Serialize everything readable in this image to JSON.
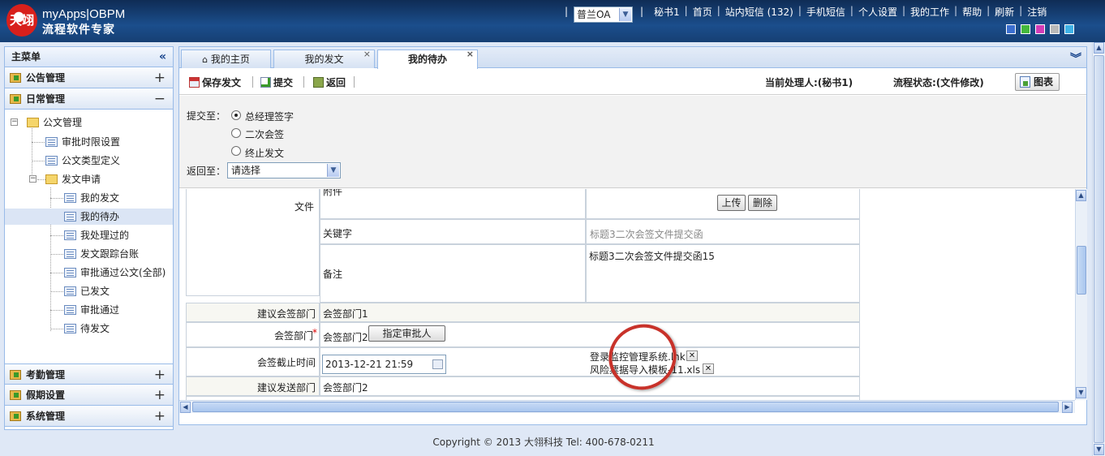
{
  "app": {
    "logo_mark": "天翊",
    "title": "myApps|OBPM",
    "subtitle": "流程软件专家"
  },
  "header": {
    "system_select": "普兰OA",
    "links": [
      "秘书1",
      "首页",
      "站内短信 (132)",
      "手机短信",
      "个人设置",
      "我的工作",
      "帮助",
      "刷新",
      "注销"
    ],
    "theme_colors": [
      "#3b6fd0",
      "#45b83c",
      "#d23cb7",
      "#b9b9b9",
      "#3fb2e6"
    ]
  },
  "sidebar": {
    "title": "主菜单",
    "collapse_icon": "«",
    "sections_top": [
      {
        "label": "公告管理",
        "toggle": "+"
      },
      {
        "label": "日常管理",
        "toggle": "−"
      }
    ],
    "tree": {
      "root": "公文管理",
      "items_level1": [
        "审批时限设置",
        "公文类型定义"
      ],
      "folder": "发文申请",
      "items_level2": [
        "我的发文",
        "我的待办",
        "我处理过的",
        "发文跟踪台账",
        "审批通过公文(全部)",
        "已发文",
        "审批通过",
        "待发文"
      ]
    },
    "sections_bottom": [
      {
        "label": "考勤管理",
        "toggle": "+"
      },
      {
        "label": "假期设置",
        "toggle": "+"
      },
      {
        "label": "系统管理",
        "toggle": "+"
      }
    ]
  },
  "tabs": [
    {
      "label": "我的主页",
      "closable": ""
    },
    {
      "label": "我的发文",
      "closable": "×"
    },
    {
      "label": "我的待办",
      "closable": "×"
    }
  ],
  "toolbar": {
    "save": "保存发文",
    "submit": "提交",
    "back": "返回",
    "current_handler": "当前处理人:(秘书1)",
    "flow_status": "流程状态:(文件修改)",
    "chart": "图表"
  },
  "submit_panel": {
    "submit_to_label": "提交至：",
    "options": [
      "总经理签字",
      "二次会签",
      "终止发文"
    ],
    "selected_option": "总经理签字",
    "return_to_label": "返回至：",
    "return_select": "请选择"
  },
  "form": {
    "file_label": "文件",
    "attachment_label": "附件",
    "upload_btn": "上传",
    "delete_btn": "删除",
    "keyword_label": "关键字",
    "keyword_value": "标题3二次会签文件提交函",
    "remark_label": "备注",
    "remark_value": "标题3二次会签文件提交函15",
    "suggest_dept_label": "建议会签部门",
    "suggest_dept_value": "会签部门1",
    "dept_label": "会签部门",
    "required_mark": "*",
    "dept_value": "会签部门2",
    "assign_btn": "指定审批人",
    "deadline_label": "会签截止时间",
    "deadline_value": "2013-12-21 21:59",
    "files": [
      "登录监控管理系统.lnk",
      "风险票据导入模板-11.xls"
    ],
    "send_dept_label": "建议发送部门",
    "send_dept_value": "会签部门2"
  },
  "footer": {
    "text": "Copyright © 2013 大翎科技  Tel: 400-678-0211"
  }
}
